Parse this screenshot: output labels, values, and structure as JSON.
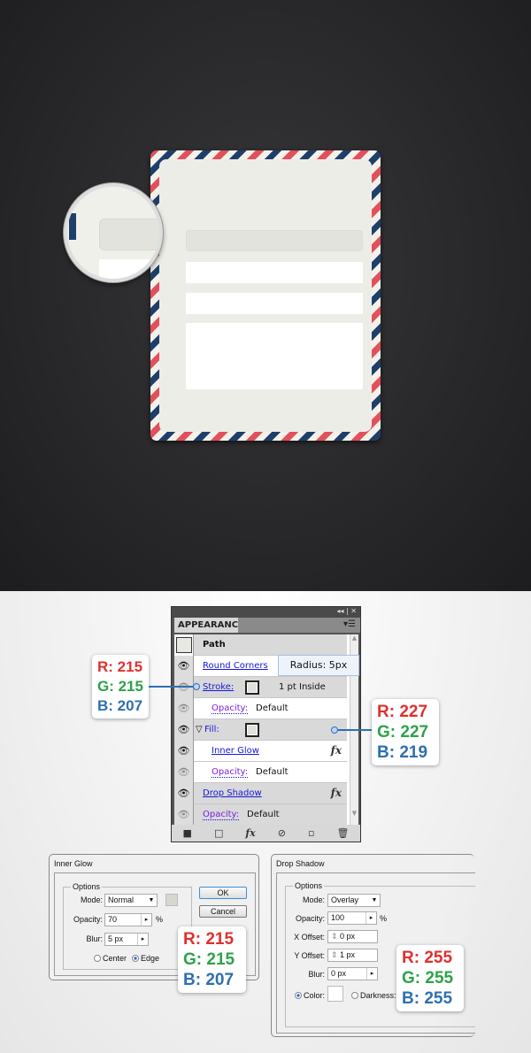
{
  "panel": {
    "title": "APPEARANCE",
    "collapse_icon": "double-chevron-left-icon",
    "close_icon": "close-icon",
    "menu_icon": "panel-menu-icon",
    "path_label": "Path",
    "rows": [
      {
        "label": "Round Corners",
        "type": "effect"
      },
      {
        "label": "Stroke:",
        "value": "1 pt  Inside"
      },
      {
        "label": "Opacity:",
        "value": "Default"
      },
      {
        "label": "Fill:"
      },
      {
        "label": "Inner Glow",
        "type": "effect"
      },
      {
        "label": "Opacity:",
        "value": "Default"
      },
      {
        "label": "Drop Shadow",
        "type": "effect"
      },
      {
        "label": "Opacity:",
        "value": "Default"
      }
    ],
    "fx": "fx",
    "tooltip": "Radius: 5px"
  },
  "callouts": {
    "stroke": {
      "r": "R: 215",
      "g": "G: 215",
      "b": "B: 207",
      "hex": "#d7d7cf"
    },
    "fill": {
      "r": "R: 227",
      "g": "G: 227",
      "b": "B: 219",
      "hex": "#e3e3db"
    },
    "inner_glow": {
      "r": "R: 215",
      "g": "G: 215",
      "b": "B: 207",
      "hex": "#d7d7cf"
    },
    "drop_shadow": {
      "r": "R: 255",
      "g": "G: 255",
      "b": "B: 255",
      "hex": "#ffffff"
    }
  },
  "inner_glow": {
    "title": "Inner Glow",
    "options": "Options",
    "mode_label": "Mode:",
    "mode": "Normal",
    "opacity_label": "Opacity:",
    "opacity": "70",
    "pct": "%",
    "blur_label": "Blur:",
    "blur": "5 px",
    "center": "Center",
    "edge": "Edge",
    "ok": "OK",
    "cancel": "Cancel"
  },
  "drop_shadow": {
    "title": "Drop Shadow",
    "options": "Options",
    "mode_label": "Mode:",
    "mode": "Overlay",
    "opacity_label": "Opacity:",
    "opacity": "100",
    "pct": "%",
    "x_label": "X Offset:",
    "x": "0 px",
    "y_label": "Y Offset:",
    "y": "1 px",
    "blur_label": "Blur:",
    "blur": "0 px",
    "color_label": "Color:",
    "darkness_label": "Darkness:"
  },
  "colors": {
    "stripe_red": "#e2505b",
    "stripe_blue": "#1e3f6b",
    "envelope": "#edede7"
  }
}
